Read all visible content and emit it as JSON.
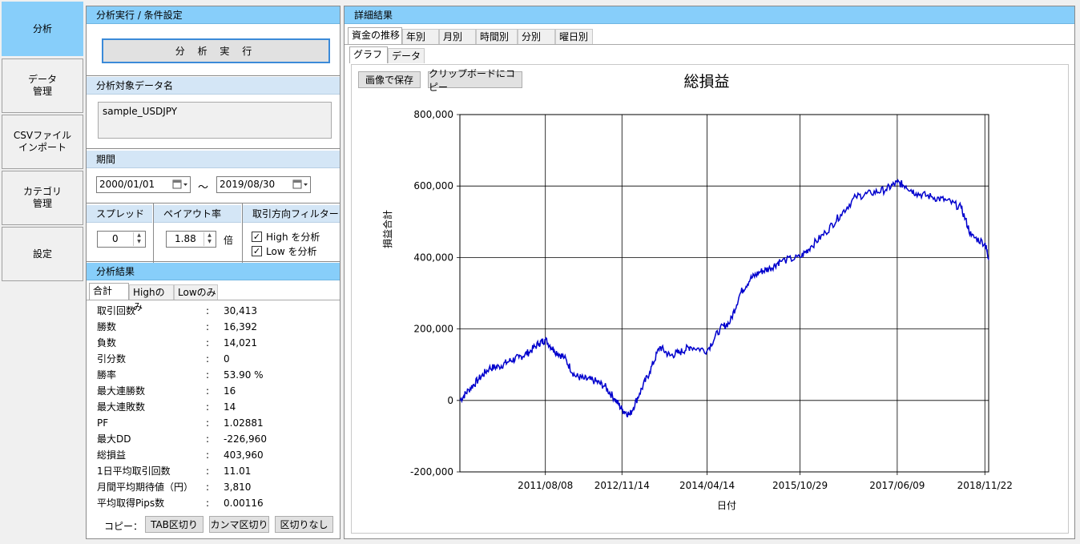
{
  "nav": {
    "items": [
      {
        "label": "分析"
      },
      {
        "label": "データ\n管理"
      },
      {
        "label": "CSVファイル\nインポート"
      },
      {
        "label": "カテゴリ\n管理"
      },
      {
        "label": "設定"
      }
    ]
  },
  "left": {
    "header": "分析実行 / 条件設定",
    "run_button": "分 析 実 行",
    "target_header": "分析対象データ名",
    "target_value": "sample_USDJPY",
    "period_header": "期間",
    "date_from": "2000/01/01",
    "date_sep": "～",
    "date_to": "2019/08/30",
    "spread_header": "スプレッド",
    "spread_value": "0",
    "payout_header": "ペイアウト率",
    "payout_value": "1.88",
    "payout_unit": "倍",
    "filter_header": "取引方向フィルター",
    "filter_high": "High を分析",
    "filter_low": "Low を分析",
    "check_mark": "✓",
    "results_header": "分析結果",
    "tabs": [
      "合計",
      "Highのみ",
      "Lowのみ"
    ],
    "colon": ":",
    "results": [
      {
        "k": "取引回数",
        "v": "30,413"
      },
      {
        "k": "勝数",
        "v": "16,392"
      },
      {
        "k": "負数",
        "v": "14,021"
      },
      {
        "k": "引分数",
        "v": "0"
      },
      {
        "k": "勝率",
        "v": "53.90 %"
      },
      {
        "k": "最大連勝数",
        "v": "16"
      },
      {
        "k": "最大連敗数",
        "v": "14"
      },
      {
        "k": "PF",
        "v": "1.02881"
      },
      {
        "k": "最大DD",
        "v": "-226,960"
      },
      {
        "k": "総損益",
        "v": "403,960"
      },
      {
        "k": "1日平均取引回数",
        "v": "11.01"
      },
      {
        "k": "月間平均期待値（円）",
        "v": "3,810"
      },
      {
        "k": "平均取得Pips数",
        "v": "0.00116"
      }
    ],
    "copy_label": "コピー：",
    "copy_tab": "TAB区切り",
    "copy_comma": "カンマ区切り",
    "copy_none": "区切りなし"
  },
  "right": {
    "header": "詳細結果",
    "tabs": [
      "資金の推移",
      "年別",
      "月別",
      "時間別",
      "分別",
      "曜日別"
    ],
    "subtabs": [
      "グラフ",
      "データ"
    ],
    "save_image": "画像で保存",
    "copy_clipboard": "クリップボードにコピー"
  },
  "chart_data": {
    "type": "line",
    "title": "総損益",
    "xlabel": "日付",
    "ylabel": "損益合計",
    "ylim": [
      -200000,
      800000
    ],
    "yticks": [
      "800,000",
      "600,000",
      "400,000",
      "200,000",
      "0",
      "-200,000"
    ],
    "xticks": [
      "2011/08/08",
      "2012/11/14",
      "2014/04/14",
      "2015/10/29",
      "2017/06/09",
      "2018/11/22"
    ],
    "grid": true,
    "color": "#0000cd",
    "series": [
      {
        "x": [
          "2010/03/08",
          "2010/05/01",
          "2010/07/01",
          "2010/09/01",
          "2010/11/01",
          "2011/01/01",
          "2011/03/01",
          "2011/05/01",
          "2011/07/01",
          "2011/08/08",
          "2011/10/01",
          "2011/12/01",
          "2012/02/01",
          "2012/04/01",
          "2012/06/01",
          "2012/08/01",
          "2012/10/01",
          "2012/11/14",
          "2013/01/01",
          "2013/03/01",
          "2013/05/01",
          "2013/07/01",
          "2013/09/01",
          "2013/11/01",
          "2014/01/01",
          "2014/04/14",
          "2014/07/01",
          "2014/09/01",
          "2014/11/01",
          "2015/01/01",
          "2015/03/01",
          "2015/05/01",
          "2015/07/01",
          "2015/10/29",
          "2016/01/01",
          "2016/04/01",
          "2016/07/01",
          "2016/10/01",
          "2017/01/01",
          "2017/04/01",
          "2017/06/09",
          "2017/08/01",
          "2017/10/01",
          "2018/01/01",
          "2018/04/01",
          "2018/07/01",
          "2018/09/01",
          "2018/11/22",
          "2018/12/15"
        ],
        "y": [
          0,
          30000,
          60000,
          90000,
          95000,
          110000,
          120000,
          135000,
          160000,
          170000,
          140000,
          120000,
          70000,
          60000,
          55000,
          40000,
          5000,
          -25000,
          -40000,
          20000,
          80000,
          150000,
          125000,
          135000,
          150000,
          140000,
          200000,
          220000,
          300000,
          340000,
          360000,
          370000,
          390000,
          400000,
          430000,
          470000,
          520000,
          570000,
          580000,
          590000,
          610000,
          600000,
          580000,
          570000,
          560000,
          540000,
          460000,
          440000,
          400000
        ]
      }
    ]
  }
}
